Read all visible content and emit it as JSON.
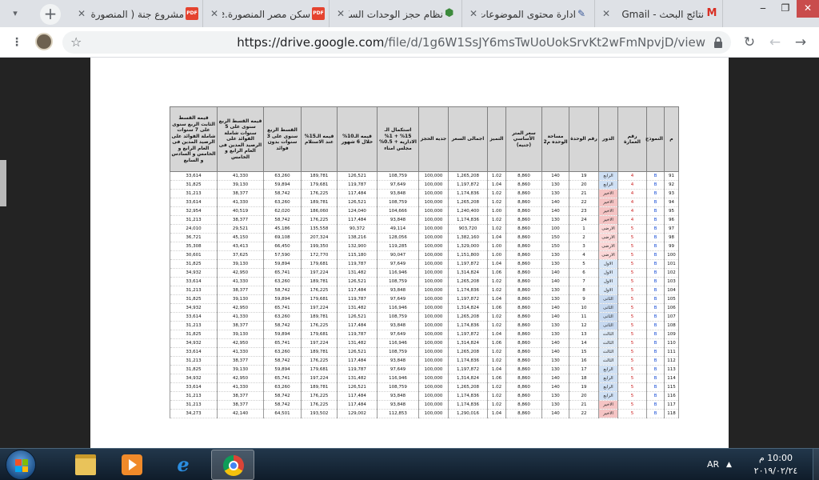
{
  "tabs": [
    {
      "title": "نتائج البحث - Gmail",
      "icon": "gmail-icon",
      "active": false
    },
    {
      "title": "ادارة محتوى الموضوعات",
      "icon": "document-icon",
      "active": false
    },
    {
      "title": "نظام حجز الوحدات السكن",
      "icon": "package-icon",
      "active": false
    },
    {
      "title": "سكن مصر المنصورة.ve",
      "icon": "pdf-icon",
      "active": false
    },
    {
      "title": "مشروع جنة ( المنصورة",
      "icon": "pdf-icon",
      "active": true
    }
  ],
  "new_tab_symbol": "+",
  "address": {
    "url_host": "https://drive.google.com",
    "url_path": "/file/d/1g6W1SsJY6msTwUoUokSrvKt2wFmNpvjD/view"
  },
  "table": {
    "headers": [
      "م",
      "النموذج",
      "رقم العمارة",
      "الدور",
      "رقم الوحدة",
      "مساحة الوحده م2",
      "سعر المتر الأساسي (جنيه)",
      "التميز",
      "اجمالى السعر",
      "جديه الحجز",
      "استكمال الـ 15% + 1% الاداريه + 0.5% مجلس امناء",
      "قيمه الـ10% خلال 6 شهور",
      "قيمه الـ15% عند الاستلام",
      "القسط الربع سنوى على 3 سنوات بدون فوائد",
      "قيمه القسط الربع سنوى على 5 سنوات شاملة الفوائد على الرصيد المدين فى العام الرابع و الخامس",
      "قيمه القسط الثابت الربع سنوى على 7 سنوات شاملة الفوائد على الرصيد المدين فى العام الرابع و الخامس و السادس و السابع"
    ],
    "rows": [
      [
        "91",
        "B",
        "4",
        "الرابع",
        "19",
        "140",
        "8,860",
        "1.02",
        "1,265,208",
        "100,000",
        "108,759",
        "126,521",
        "189,781",
        "63,260",
        "41,330",
        "33,614"
      ],
      [
        "92",
        "B",
        "4",
        "الرابع",
        "20",
        "130",
        "8,860",
        "1.04",
        "1,197,872",
        "100,000",
        "97,649",
        "119,787",
        "179,681",
        "59,894",
        "39,130",
        "31,825"
      ],
      [
        "93",
        "B",
        "4",
        "الاخير",
        "21",
        "130",
        "8,860",
        "1.02",
        "1,174,836",
        "100,000",
        "93,848",
        "117,484",
        "176,225",
        "58,742",
        "38,377",
        "31,213"
      ],
      [
        "94",
        "B",
        "4",
        "الاخير",
        "22",
        "140",
        "8,860",
        "1.02",
        "1,265,208",
        "100,000",
        "108,759",
        "126,521",
        "189,781",
        "63,260",
        "41,330",
        "33,614"
      ],
      [
        "95",
        "B",
        "4",
        "الاخير",
        "23",
        "140",
        "8,860",
        "1.00",
        "1,240,400",
        "100,000",
        "104,666",
        "124,040",
        "186,060",
        "62,020",
        "40,519",
        "32,954"
      ],
      [
        "96",
        "B",
        "4",
        "الاخير",
        "24",
        "130",
        "8,860",
        "1.02",
        "1,174,836",
        "100,000",
        "93,848",
        "117,484",
        "176,225",
        "58,742",
        "38,377",
        "31,213"
      ],
      [
        "97",
        "B",
        "5",
        "الارضى",
        "1",
        "100",
        "8,860",
        "1.02",
        "903,720",
        "100,000",
        "49,114",
        "90,372",
        "135,558",
        "45,186",
        "29,521",
        "24,010"
      ],
      [
        "98",
        "B",
        "5",
        "الارضى",
        "2",
        "150",
        "8,860",
        "1.04",
        "1,382,160",
        "100,000",
        "128,056",
        "138,216",
        "207,324",
        "69,108",
        "45,150",
        "36,721"
      ],
      [
        "99",
        "B",
        "5",
        "الارضى",
        "3",
        "150",
        "8,860",
        "1.00",
        "1,329,000",
        "100,000",
        "119,285",
        "132,900",
        "199,350",
        "66,450",
        "43,413",
        "35,308"
      ],
      [
        "100",
        "B",
        "5",
        "الارضى",
        "4",
        "130",
        "8,860",
        "1.00",
        "1,151,800",
        "100,000",
        "90,047",
        "115,180",
        "172,770",
        "57,590",
        "37,625",
        "30,601"
      ],
      [
        "101",
        "B",
        "5",
        "الاول",
        "5",
        "130",
        "8,860",
        "1.04",
        "1,197,872",
        "100,000",
        "97,649",
        "119,787",
        "179,681",
        "59,894",
        "39,130",
        "31,825"
      ],
      [
        "102",
        "B",
        "5",
        "الاول",
        "6",
        "140",
        "8,860",
        "1.06",
        "1,314,824",
        "100,000",
        "116,946",
        "131,482",
        "197,224",
        "65,741",
        "42,950",
        "34,932"
      ],
      [
        "103",
        "B",
        "5",
        "الاول",
        "7",
        "140",
        "8,860",
        "1.02",
        "1,265,208",
        "100,000",
        "108,759",
        "126,521",
        "189,781",
        "63,260",
        "41,330",
        "33,614"
      ],
      [
        "104",
        "B",
        "5",
        "الاول",
        "8",
        "130",
        "8,860",
        "1.02",
        "1,174,836",
        "100,000",
        "93,848",
        "117,484",
        "176,225",
        "58,742",
        "38,377",
        "31,213"
      ],
      [
        "105",
        "B",
        "5",
        "الثانى",
        "9",
        "130",
        "8,860",
        "1.04",
        "1,197,872",
        "100,000",
        "97,649",
        "119,787",
        "179,681",
        "59,894",
        "39,130",
        "31,825"
      ],
      [
        "106",
        "B",
        "5",
        "الثانى",
        "10",
        "140",
        "8,860",
        "1.06",
        "1,314,824",
        "100,000",
        "116,946",
        "131,482",
        "197,224",
        "65,741",
        "42,950",
        "34,932"
      ],
      [
        "107",
        "B",
        "5",
        "الثانى",
        "11",
        "140",
        "8,860",
        "1.02",
        "1,265,208",
        "100,000",
        "108,759",
        "126,521",
        "189,781",
        "63,260",
        "41,330",
        "33,614"
      ],
      [
        "108",
        "B",
        "5",
        "الثانى",
        "12",
        "130",
        "8,860",
        "1.02",
        "1,174,836",
        "100,000",
        "93,848",
        "117,484",
        "176,225",
        "58,742",
        "38,377",
        "31,213"
      ],
      [
        "109",
        "B",
        "5",
        "الثالث",
        "13",
        "130",
        "8,860",
        "1.04",
        "1,197,872",
        "100,000",
        "97,649",
        "119,787",
        "179,681",
        "59,894",
        "39,130",
        "31,825"
      ],
      [
        "110",
        "B",
        "5",
        "الثالث",
        "14",
        "140",
        "8,860",
        "1.06",
        "1,314,824",
        "100,000",
        "116,946",
        "131,482",
        "197,224",
        "65,741",
        "42,950",
        "34,932"
      ],
      [
        "111",
        "B",
        "5",
        "الثالث",
        "15",
        "140",
        "8,860",
        "1.02",
        "1,265,208",
        "100,000",
        "108,759",
        "126,521",
        "189,781",
        "63,260",
        "41,330",
        "33,614"
      ],
      [
        "112",
        "B",
        "5",
        "الثالث",
        "16",
        "130",
        "8,860",
        "1.02",
        "1,174,836",
        "100,000",
        "93,848",
        "117,484",
        "176,225",
        "58,742",
        "38,377",
        "31,213"
      ],
      [
        "113",
        "B",
        "5",
        "الرابع",
        "17",
        "130",
        "8,860",
        "1.04",
        "1,197,872",
        "100,000",
        "97,649",
        "119,787",
        "179,681",
        "59,894",
        "39,130",
        "31,825"
      ],
      [
        "114",
        "B",
        "5",
        "الرابع",
        "18",
        "140",
        "8,860",
        "1.06",
        "1,314,824",
        "100,000",
        "116,946",
        "131,482",
        "197,224",
        "65,741",
        "42,950",
        "34,932"
      ],
      [
        "115",
        "B",
        "5",
        "الرابع",
        "19",
        "140",
        "8,860",
        "1.02",
        "1,265,208",
        "100,000",
        "108,759",
        "126,521",
        "189,781",
        "63,260",
        "41,330",
        "33,614"
      ],
      [
        "116",
        "B",
        "5",
        "الرابع",
        "20",
        "130",
        "8,860",
        "1.02",
        "1,174,836",
        "100,000",
        "93,848",
        "117,484",
        "176,225",
        "58,742",
        "38,377",
        "31,213"
      ],
      [
        "117",
        "B",
        "5",
        "الاخير",
        "21",
        "130",
        "8,860",
        "1.02",
        "1,174,836",
        "100,000",
        "93,848",
        "117,484",
        "176,225",
        "58,742",
        "38,377",
        "31,213"
      ],
      [
        "118",
        "B",
        "5",
        "الاخير",
        "22",
        "140",
        "8,860",
        "1.04",
        "1,290,016",
        "100,000",
        "112,853",
        "129,002",
        "193,502",
        "64,501",
        "42,140",
        "34,273"
      ]
    ]
  },
  "taskbar": {
    "apps": [
      "start-button",
      "file-explorer",
      "media-player",
      "internet-explorer",
      "chrome"
    ],
    "language": "AR",
    "time": "10:00 م",
    "date": "٢٠١٩/٠٢/٢٤"
  },
  "colors": {
    "floor_roof": "#f5c4c4",
    "floor_ground": "#fbd7d7",
    "floor_upper": "#d7e6f7",
    "model_text": "#1a4fd6",
    "building_text": "#cc1f1f"
  }
}
